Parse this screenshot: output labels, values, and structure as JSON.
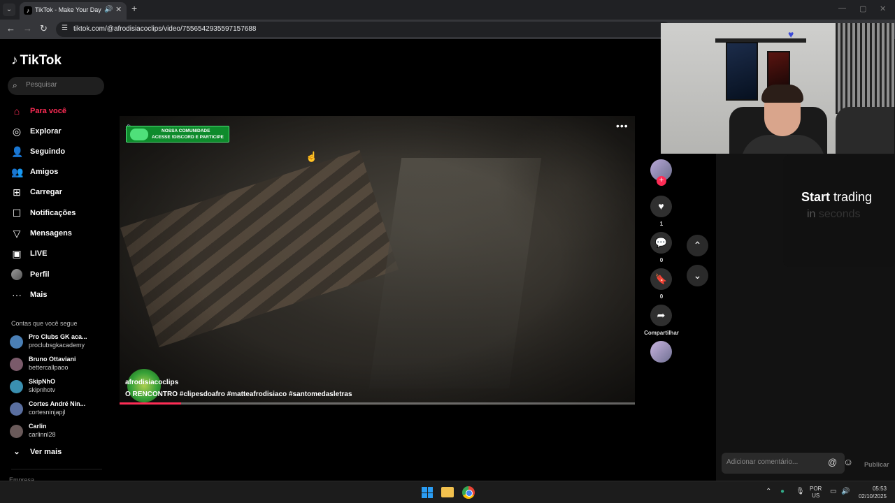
{
  "browser": {
    "tab_title": "TikTok - Make Your Day",
    "url": "tiktok.com/@afrodisiacoclips/video/7556542935597157688"
  },
  "sidebar": {
    "logo": "TikTok",
    "search_placeholder": "Pesquisar",
    "items": [
      {
        "label": "Para você",
        "icon": "home-icon"
      },
      {
        "label": "Explorar",
        "icon": "compass-icon"
      },
      {
        "label": "Seguindo",
        "icon": "following-icon"
      },
      {
        "label": "Amigos",
        "icon": "friends-icon"
      },
      {
        "label": "Carregar",
        "icon": "upload-icon"
      },
      {
        "label": "Notificações",
        "icon": "notification-icon"
      },
      {
        "label": "Mensagens",
        "icon": "message-icon"
      },
      {
        "label": "LIVE",
        "icon": "live-icon"
      },
      {
        "label": "Perfil",
        "icon": "profile-avatar"
      },
      {
        "label": "Mais",
        "icon": "more-icon"
      }
    ],
    "following_title": "Contas que você segue",
    "accounts": [
      {
        "name": "Pro Clubs GK aca...",
        "handle": "proclubsgkacademy",
        "color": "#4a7fb5"
      },
      {
        "name": "Bruno Ottaviani",
        "handle": "bettercallpaoo",
        "color": "#7a5a6a"
      },
      {
        "name": "SkipNhO",
        "handle": "skipnhotv",
        "color": "#3a8fb0"
      },
      {
        "name": "Cortes André Nin...",
        "handle": "cortesninjapjl",
        "color": "#5a6fa0"
      },
      {
        "name": "Carlin",
        "handle": "carlinnl28",
        "color": "#6a5a5a"
      }
    ],
    "see_more": "Ver mais",
    "footer": "Empresa"
  },
  "video": {
    "banner_line1": "NOSSA COMUNIDADE",
    "banner_line2": "ACESSE !DISCORD E PARTICIPE",
    "author": "afrodisiacoclips",
    "caption": "O RENCONTRO #clipesdoafro  #matteafrodisiaco  #santomedasletras",
    "progress": 0.12
  },
  "actions": {
    "likes": "1",
    "comments": "0",
    "saves": "0",
    "share_label": "Compartilhar"
  },
  "ad": {
    "line1_bold": "Start",
    "line1_rest": "trading",
    "line2_a": "in",
    "line2_b": "seconds"
  },
  "comments": {
    "placeholder": "Adicionar comentário...",
    "publish": "Publicar"
  },
  "taskbar": {
    "lang1": "POR",
    "lang2": "US",
    "time": "05:53",
    "date": "02/10/2025"
  },
  "colors": {
    "accent": "#fe2c55",
    "banner": "#0e8b2c"
  }
}
